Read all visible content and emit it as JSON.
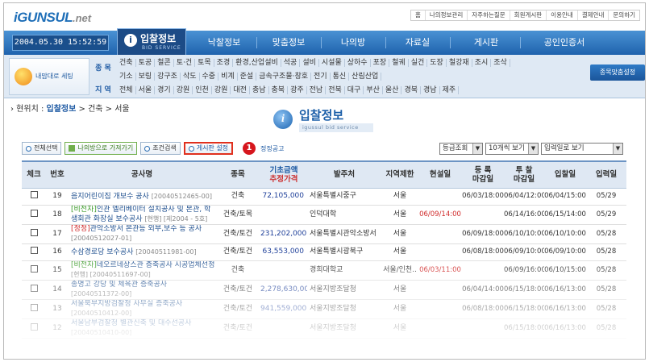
{
  "logo": {
    "main": "iGUNSUL",
    "suffix": ".net"
  },
  "top_links": [
    "홈",
    "나의정보관리",
    "자주하는질문",
    "회원게시판",
    "이용안내",
    "결제안내",
    "문의하기"
  ],
  "clock": "2004.05.30 15:52:59",
  "nav": {
    "active": {
      "label": "입찰정보",
      "sub": "BID SERVICE"
    },
    "tabs": [
      "낙찰정보",
      "맞춤정보",
      "나의방",
      "자료실",
      "게시판",
      "공인인증서"
    ]
  },
  "sub_nav": {
    "my_setting": "내맘대로 세팅",
    "category_label": "종 목",
    "categories_row1": [
      "건축",
      "토공",
      "철콘",
      "토·건",
      "토목",
      "조경",
      "환경,산업설비",
      "석공",
      "설비",
      "시설물",
      "상하수",
      "포장",
      "철궤",
      "실건",
      "도장",
      "철강재",
      "조시",
      "조삭"
    ],
    "categories_row2": [
      "기소",
      "보링",
      "강구조",
      "삭도",
      "수중",
      "비계",
      "준설",
      "금속구조물·창호",
      "전기",
      "통신",
      "산림산업"
    ],
    "region_label": "지 역",
    "regions": [
      "전체",
      "서울",
      "경기",
      "강원",
      "인천",
      "강원",
      "대전",
      "충남",
      "충북",
      "광주",
      "전남",
      "전북",
      "대구",
      "부산",
      "울산",
      "경북",
      "경남",
      "제주"
    ],
    "custom_button": "종목맞춤설정"
  },
  "breadcrumb": {
    "prefix": "› 현위치 :",
    "current": "입찰정보",
    "rest": "> 건축 > 서울"
  },
  "page_heading": {
    "title": "입찰정보",
    "subtitle": "igussul bid service"
  },
  "toolbar": {
    "select_all": "전체선택",
    "to_myroom": "나의방으로 가져가기",
    "condition_search": "조건검색",
    "board_setting": "게시판 설정",
    "badge": "1",
    "regular_notice": "정정공고",
    "grade_select": "등급조회",
    "per_page_select": "10개씩 보기",
    "order_select": "입력일로 보기"
  },
  "table": {
    "headers": {
      "check": "체크",
      "no": "번호",
      "name": "공사명",
      "category": "종목",
      "price_top": "기초금액",
      "price_bottom": "추정가격",
      "client": "발주처",
      "region": "지역제한",
      "site": "현설일",
      "reg_top": "등 록",
      "reg_bottom": "마감일",
      "bid_top": "투 찰",
      "bid_bottom": "마감일",
      "open": "입찰일",
      "input": "입력일"
    },
    "rows": [
      {
        "no": "19",
        "tag": "",
        "title": "음지어린이집 개보수 공사",
        "code": "[20040512465-00]",
        "category": "건축",
        "price": "72,105,000",
        "client": "서울특별시중구",
        "region": "서울",
        "site": "",
        "reg": "06/03/18:00",
        "bid": "06/04/12:00",
        "open": "06/04/15:00",
        "input": "05/29"
      },
      {
        "no": "18",
        "tag": "[비전자]",
        "title": "인관 엘리베이터 설치공사 및 본관, 학생회관 화장실 보수공사",
        "code": "[현행] [제2004 - 5호]",
        "category": "건축/토목",
        "price": "",
        "client": "인덕대학",
        "region": "서울",
        "site": "06/09/14:00",
        "reg": "",
        "bid": "06/14/16:00",
        "open": "06/15/14:00",
        "input": "05/29"
      },
      {
        "no": "17",
        "tag": "[정정]",
        "title": "관악소방서 본관등 외부,보수 등 공사",
        "code": "[20040512027-01]",
        "category": "건축/토건",
        "price": "231,202,000",
        "client": "서울특별시관악소방서",
        "region": "서울",
        "site": "",
        "reg": "06/09/18:00",
        "bid": "06/10/10:00",
        "open": "06/10/10:00",
        "input": "05/28"
      },
      {
        "no": "16",
        "tag": "",
        "title": "수삼경로당 보수공사",
        "code": "[20040511981-00]",
        "category": "건축/토건",
        "price": "63,553,000",
        "client": "서울특별시광북구",
        "region": "서울",
        "site": "",
        "reg": "06/08/18:00",
        "bid": "06/09/10:00",
        "open": "06/09/10:00",
        "input": "05/28"
      },
      {
        "no": "15",
        "tag": "[비전자]",
        "title": "네오르네상스관 증축공사 시공업체선정",
        "code": "[현행] [20040511697-00]",
        "category": "건축",
        "price": "",
        "client": "경희대학교",
        "region": "서울/인천..",
        "site": "06/03/11:00",
        "reg": "",
        "bid": "06/09/16:00",
        "open": "06/10/15:00",
        "input": "05/28"
      },
      {
        "no": "14",
        "tag": "",
        "title": "종명고 강당 및 체육관 증축공사",
        "code": "[20040511372-00]",
        "category": "건축/토건",
        "price": "2,278,630,000",
        "client": "서울지방조달청",
        "region": "서울",
        "site": "",
        "reg": "06/04/14:00",
        "bid": "06/15/18:00",
        "open": "06/16/13:00",
        "input": "05/28"
      },
      {
        "no": "13",
        "tag": "",
        "title": "서울북부지방검찰청 사무실 증축공사",
        "code": "[20040510412-00]",
        "category": "건축/토건",
        "price": "941,559,000",
        "client": "서울지방조달청",
        "region": "서울",
        "site": "",
        "reg": "06/08/18:00",
        "bid": "06/15/18:00",
        "open": "06/16/13:00",
        "input": "05/28"
      },
      {
        "no": "12",
        "tag": "",
        "title": "서울남부검찰청 별관신축 및 대수선공사",
        "code": "[20040510410-00]",
        "category": "건축/토건",
        "price": "",
        "client": "서울지방조달청",
        "region": "서울",
        "site": "",
        "reg": "",
        "bid": "06/15/18:00",
        "open": "06/16/13:00",
        "input": "05/28"
      }
    ]
  }
}
